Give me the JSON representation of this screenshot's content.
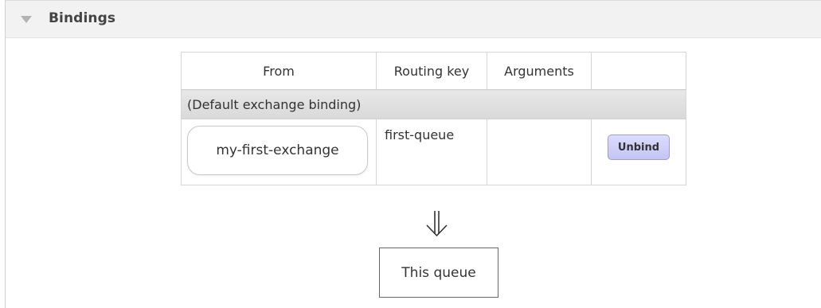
{
  "section": {
    "title": "Bindings",
    "collapse_icon": "triangle-down-icon"
  },
  "table": {
    "headers": {
      "from": "From",
      "routing_key": "Routing key",
      "arguments": "Arguments",
      "actions": ""
    },
    "group_label": "(Default exchange binding)",
    "rows": [
      {
        "from": "my-first-exchange",
        "routing_key": "first-queue",
        "arguments": "",
        "action_label": "Unbind"
      }
    ]
  },
  "flow": {
    "arrow_icon": "double-down-arrow-icon",
    "target_label": "This queue"
  },
  "colors": {
    "header_background": "#f2f2f2",
    "group_row_background": "#dedede",
    "unbind_button": "#d0d0fa",
    "unbind_border": "#9c9cd8"
  }
}
